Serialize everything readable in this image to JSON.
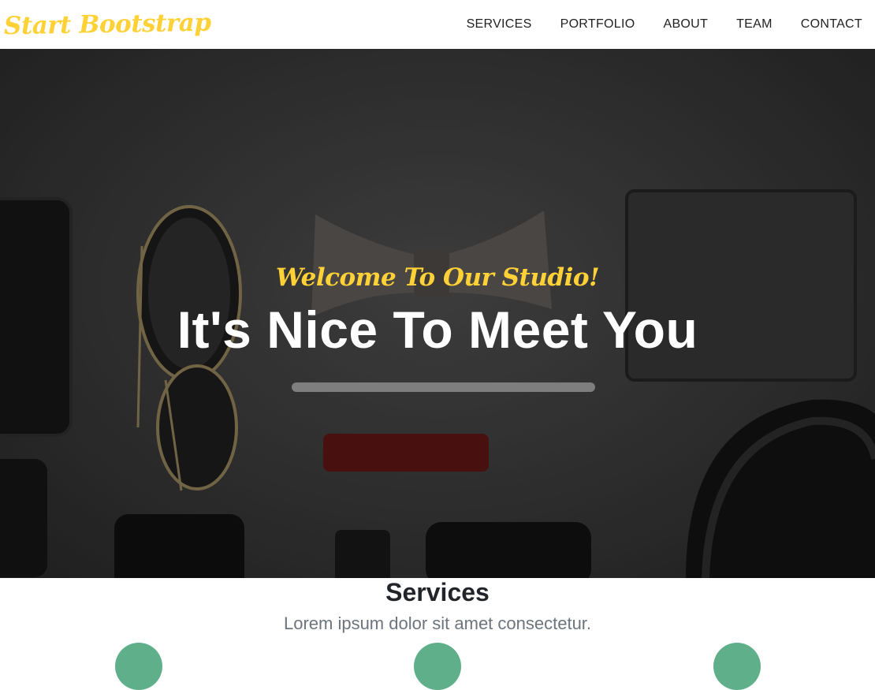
{
  "navbar": {
    "brand": "Start Bootstrap",
    "links": [
      "SERVICES",
      "PORTFOLIO",
      "ABOUT",
      "TEAM",
      "CONTACT"
    ]
  },
  "hero": {
    "subheading": "Welcome To Our Studio!",
    "heading": "It's Nice To Meet You"
  },
  "services": {
    "title": "Services",
    "subtitle": "Lorem ipsum dolor sit amet consectetur.",
    "icons": [
      "service-icon",
      "service-icon",
      "service-icon"
    ]
  },
  "colors": {
    "accent": "#fed136",
    "nav_text": "#222222",
    "heading_text": "#212529",
    "muted_text": "#6c757d",
    "icon_circle": "#5faf8a"
  }
}
